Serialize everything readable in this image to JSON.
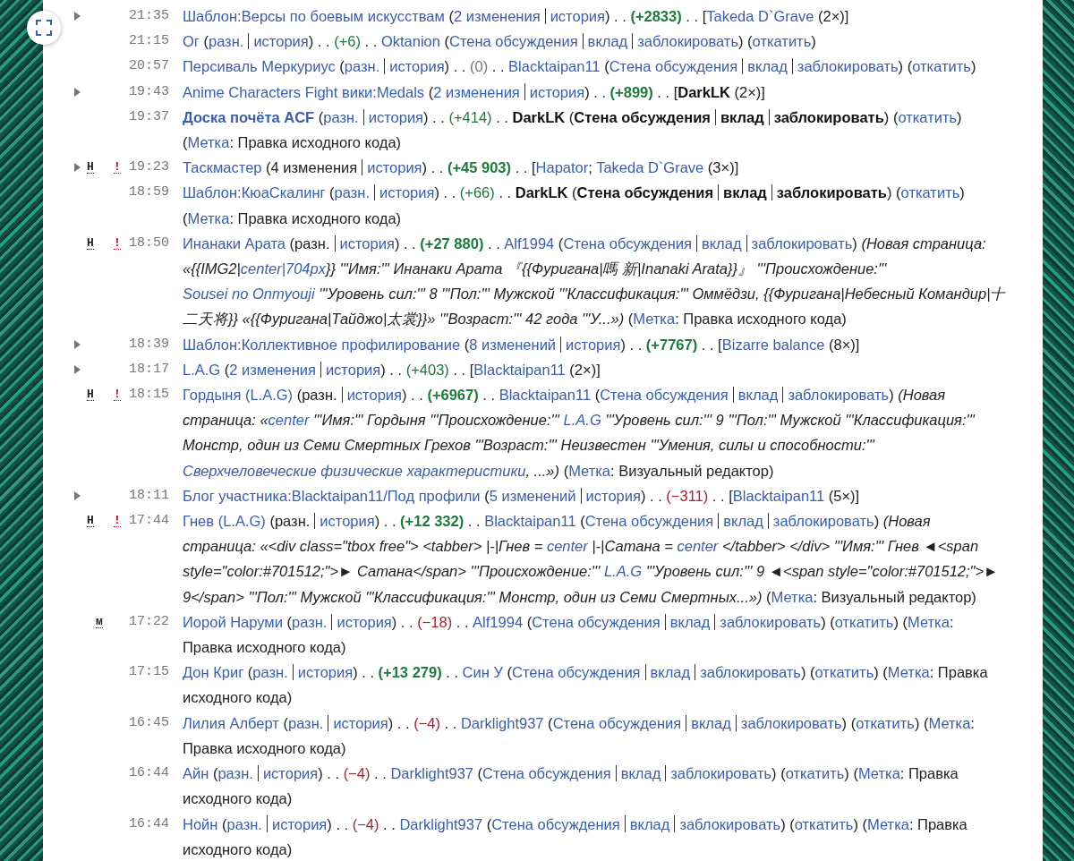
{
  "entries": [
    {
      "time": "21:35",
      "kind": "group",
      "expanded": false,
      "parts": [
        {
          "kind": "link",
          "t": "Шаблон:Версы по боевым искусствам"
        },
        {
          "kind": "text",
          "t": " ("
        },
        {
          "kind": "link",
          "t": "2 изменения"
        },
        {
          "kind": "sep"
        },
        {
          "kind": "link",
          "t": "история"
        },
        {
          "kind": "text",
          "t": ") . . "
        },
        {
          "kind": "size-up",
          "t": "(+2833)",
          "bold": true
        },
        {
          "kind": "text",
          "t": " . . ["
        },
        {
          "kind": "link",
          "t": "Takeda D`Grave"
        },
        {
          "kind": "text",
          "t": " (2×)]"
        }
      ]
    },
    {
      "time": "21:15",
      "kind": "single",
      "parts": [
        {
          "kind": "link",
          "t": "Ог"
        },
        {
          "kind": "text",
          "t": " ("
        },
        {
          "kind": "link",
          "t": "разн."
        },
        {
          "kind": "sep"
        },
        {
          "kind": "link",
          "t": "история"
        },
        {
          "kind": "text",
          "t": ") . . "
        },
        {
          "kind": "size-up",
          "t": "(+6)"
        },
        {
          "kind": "text",
          "t": " . . "
        },
        {
          "kind": "link",
          "t": "Oktanion"
        },
        {
          "kind": "text",
          "t": " ("
        },
        {
          "kind": "link",
          "t": "Стена обсуждения"
        },
        {
          "kind": "sep"
        },
        {
          "kind": "link",
          "t": "вклад"
        },
        {
          "kind": "sep"
        },
        {
          "kind": "link",
          "t": "заблокировать"
        },
        {
          "kind": "text",
          "t": ") ("
        },
        {
          "kind": "link",
          "t": "откатить"
        },
        {
          "kind": "text",
          "t": ")"
        }
      ]
    },
    {
      "time": "20:57",
      "kind": "single",
      "parts": [
        {
          "kind": "link",
          "t": "Персиваль Меркуриус"
        },
        {
          "kind": "text",
          "t": " ("
        },
        {
          "kind": "link",
          "t": "разн."
        },
        {
          "kind": "sep"
        },
        {
          "kind": "link",
          "t": "история"
        },
        {
          "kind": "text",
          "t": ") . . "
        },
        {
          "kind": "size-zero",
          "t": "(0)"
        },
        {
          "kind": "text",
          "t": " . . "
        },
        {
          "kind": "link",
          "t": "Blacktaipan11"
        },
        {
          "kind": "text",
          "t": " ("
        },
        {
          "kind": "link",
          "t": "Стена обсуждения"
        },
        {
          "kind": "sep"
        },
        {
          "kind": "link",
          "t": "вклад"
        },
        {
          "kind": "sep"
        },
        {
          "kind": "link",
          "t": "заблокировать"
        },
        {
          "kind": "text",
          "t": ") ("
        },
        {
          "kind": "link",
          "t": "откатить"
        },
        {
          "kind": "text",
          "t": ")"
        }
      ]
    },
    {
      "time": "19:43",
      "kind": "group",
      "expanded": false,
      "parts": [
        {
          "kind": "link",
          "t": "Anime Characters Fight вики:Medals"
        },
        {
          "kind": "text",
          "t": " ("
        },
        {
          "kind": "link",
          "t": "2 изменения"
        },
        {
          "kind": "sep"
        },
        {
          "kind": "link",
          "t": "история"
        },
        {
          "kind": "text",
          "t": ") . . "
        },
        {
          "kind": "size-up",
          "t": "(+899)",
          "bold": true
        },
        {
          "kind": "text",
          "t": " . . ["
        },
        {
          "kind": "self",
          "t": "DarkLK"
        },
        {
          "kind": "text",
          "t": " (2×)]"
        }
      ]
    },
    {
      "time": "19:37",
      "kind": "single",
      "parts": [
        {
          "kind": "link",
          "t": "Доска почёта ACF",
          "bold": true
        },
        {
          "kind": "text",
          "t": " ("
        },
        {
          "kind": "link",
          "t": "разн."
        },
        {
          "kind": "sep"
        },
        {
          "kind": "link",
          "t": "история"
        },
        {
          "kind": "text",
          "t": ") . . "
        },
        {
          "kind": "size-up",
          "t": "(+414)"
        },
        {
          "kind": "text",
          "t": " . . "
        },
        {
          "kind": "self",
          "t": "DarkLK"
        },
        {
          "kind": "text",
          "t": " ("
        },
        {
          "kind": "self",
          "t": "Стена обсуждения"
        },
        {
          "kind": "sep"
        },
        {
          "kind": "self",
          "t": "вклад"
        },
        {
          "kind": "sep"
        },
        {
          "kind": "self",
          "t": "заблокировать"
        },
        {
          "kind": "text",
          "t": ") ("
        },
        {
          "kind": "link",
          "t": "откатить"
        },
        {
          "kind": "text",
          "t": ") ("
        },
        {
          "kind": "link",
          "t": "Метка"
        },
        {
          "kind": "text",
          "t": ": Правка исходного кода)"
        }
      ]
    },
    {
      "time": "19:23",
      "kind": "group",
      "expanded": false,
      "flags": [
        {
          "kind": "new",
          "t": "Н"
        },
        {
          "kind": "unpatrolled",
          "t": "!"
        }
      ],
      "parts": [
        {
          "kind": "link",
          "t": "Таскмастер"
        },
        {
          "kind": "text",
          "t": " (4 изменения"
        },
        {
          "kind": "sep"
        },
        {
          "kind": "link",
          "t": "история"
        },
        {
          "kind": "text",
          "t": ") . . "
        },
        {
          "kind": "size-up",
          "t": "(+45 903)",
          "bold": true
        },
        {
          "kind": "text",
          "t": " . . ["
        },
        {
          "kind": "link",
          "t": "Hapator"
        },
        {
          "kind": "text",
          "t": "; "
        },
        {
          "kind": "link",
          "t": "Takeda D`Grave"
        },
        {
          "kind": "text",
          "t": " (3×)]"
        }
      ]
    },
    {
      "time": "18:59",
      "kind": "single",
      "parts": [
        {
          "kind": "link",
          "t": "Шаблон:КюаСкалинг"
        },
        {
          "kind": "text",
          "t": " ("
        },
        {
          "kind": "link",
          "t": "разн."
        },
        {
          "kind": "sep"
        },
        {
          "kind": "link",
          "t": "история"
        },
        {
          "kind": "text",
          "t": ") . . "
        },
        {
          "kind": "size-up",
          "t": "(+66)"
        },
        {
          "kind": "text",
          "t": " . . "
        },
        {
          "kind": "self",
          "t": "DarkLK"
        },
        {
          "kind": "text",
          "t": " ("
        },
        {
          "kind": "self",
          "t": "Стена обсуждения"
        },
        {
          "kind": "sep"
        },
        {
          "kind": "self",
          "t": "вклад"
        },
        {
          "kind": "sep"
        },
        {
          "kind": "self",
          "t": "заблокировать"
        },
        {
          "kind": "text",
          "t": ") ("
        },
        {
          "kind": "link",
          "t": "откатить"
        },
        {
          "kind": "text",
          "t": ") ("
        },
        {
          "kind": "link",
          "t": "Метка"
        },
        {
          "kind": "text",
          "t": ": Правка исходного кода)"
        }
      ]
    },
    {
      "time": "18:50",
      "kind": "single",
      "flags": [
        {
          "kind": "new",
          "t": "Н"
        },
        {
          "kind": "unpatrolled",
          "t": "!"
        }
      ],
      "parts": [
        {
          "kind": "link",
          "t": "Инанаки Арата"
        },
        {
          "kind": "text",
          "t": " (разн."
        },
        {
          "kind": "sep"
        },
        {
          "kind": "link",
          "t": "история"
        },
        {
          "kind": "text",
          "t": ") . . "
        },
        {
          "kind": "size-up",
          "t": "(+27 880)",
          "bold": true
        },
        {
          "kind": "text",
          "t": " . . "
        },
        {
          "kind": "link",
          "t": "Alf1994"
        },
        {
          "kind": "text",
          "t": " ("
        },
        {
          "kind": "link",
          "t": "Стена обсуждения"
        },
        {
          "kind": "sep"
        },
        {
          "kind": "link",
          "t": "вклад"
        },
        {
          "kind": "sep"
        },
        {
          "kind": "link",
          "t": "заблокировать"
        },
        {
          "kind": "text",
          "t": ") "
        },
        {
          "kind": "comment",
          "segs": [
            {
              "kind": "text",
              "t": "(Новая страница: «{{IMG2|"
            },
            {
              "kind": "link",
              "t": "center|704px"
            },
            {
              "kind": "text",
              "t": "}} '''Имя:''' Инанаки Арата 『{{Фуригана|嗎 新|Inanaki Arata}}』 '''Происхождение:''' "
            },
            {
              "kind": "link",
              "t": "Sousei no Onmyouji"
            },
            {
              "kind": "text",
              "t": " '''Уровень сил:''' 8 '''Пол:''' Мужской '''Классификация:''' Оммёдзи, {{Фуригана|Небесный Командир|十二天将}} «{{Фуригана|Тайджо|太裳}}» '''Возраст:''' 42 года '''У...»)"
            }
          ]
        },
        {
          "kind": "text",
          "t": " ("
        },
        {
          "kind": "link",
          "t": "Метка"
        },
        {
          "kind": "text",
          "t": ": Правка исходного кода)"
        }
      ]
    },
    {
      "time": "18:39",
      "kind": "group",
      "expanded": false,
      "parts": [
        {
          "kind": "link",
          "t": "Шаблон:Коллективное профилирование"
        },
        {
          "kind": "text",
          "t": " ("
        },
        {
          "kind": "link",
          "t": "8 изменений"
        },
        {
          "kind": "sep"
        },
        {
          "kind": "link",
          "t": "история"
        },
        {
          "kind": "text",
          "t": ") . . "
        },
        {
          "kind": "size-up",
          "t": "(+7767)",
          "bold": true
        },
        {
          "kind": "text",
          "t": " . . ["
        },
        {
          "kind": "link",
          "t": "Bizarre balance"
        },
        {
          "kind": "text",
          "t": " (8×)]"
        }
      ]
    },
    {
      "time": "18:17",
      "kind": "group",
      "expanded": false,
      "parts": [
        {
          "kind": "link",
          "t": "L.A.G"
        },
        {
          "kind": "text",
          "t": " ("
        },
        {
          "kind": "link",
          "t": "2 изменения"
        },
        {
          "kind": "sep"
        },
        {
          "kind": "link",
          "t": "история"
        },
        {
          "kind": "text",
          "t": ") . . "
        },
        {
          "kind": "size-up",
          "t": "(+403)"
        },
        {
          "kind": "text",
          "t": " . . ["
        },
        {
          "kind": "link",
          "t": "Blacktaipan11"
        },
        {
          "kind": "text",
          "t": " (2×)]"
        }
      ]
    },
    {
      "time": "18:15",
      "kind": "single",
      "flags": [
        {
          "kind": "new",
          "t": "Н"
        },
        {
          "kind": "unpatrolled",
          "t": "!"
        }
      ],
      "parts": [
        {
          "kind": "link",
          "t": "Гордыня (L.A.G)"
        },
        {
          "kind": "text",
          "t": " (разн."
        },
        {
          "kind": "sep"
        },
        {
          "kind": "link",
          "t": "история"
        },
        {
          "kind": "text",
          "t": ") . . "
        },
        {
          "kind": "size-up",
          "t": "(+6967)",
          "bold": true
        },
        {
          "kind": "text",
          "t": " . . "
        },
        {
          "kind": "link",
          "t": "Blacktaipan11"
        },
        {
          "kind": "text",
          "t": " ("
        },
        {
          "kind": "link",
          "t": "Стена обсуждения"
        },
        {
          "kind": "sep"
        },
        {
          "kind": "link",
          "t": "вклад"
        },
        {
          "kind": "sep"
        },
        {
          "kind": "link",
          "t": "заблокировать"
        },
        {
          "kind": "text",
          "t": ") "
        },
        {
          "kind": "comment",
          "segs": [
            {
              "kind": "text",
              "t": "(Новая страница: «"
            },
            {
              "kind": "link",
              "t": "center"
            },
            {
              "kind": "text",
              "t": " '''Имя:''' Гордыня '''Происхождение:''' "
            },
            {
              "kind": "link",
              "t": "L.A.G"
            },
            {
              "kind": "text",
              "t": " '''Уровень сил:''' 9 '''Пол:''' Мужской '''Классификация:''' Монстр, один из Семи Смертных Грехов '''Возраст:''' Неизвестен '''Умения, силы и способности:''' "
            },
            {
              "kind": "link",
              "t": "Сверхчеловеческие физические характеристики"
            },
            {
              "kind": "text",
              "t": ", ...»)"
            }
          ]
        },
        {
          "kind": "text",
          "t": " ("
        },
        {
          "kind": "link",
          "t": "Метка"
        },
        {
          "kind": "text",
          "t": ": Визуальный редактор)"
        }
      ]
    },
    {
      "time": "18:11",
      "kind": "group",
      "expanded": false,
      "parts": [
        {
          "kind": "link",
          "t": "Блог участника:Blacktaipan11/Под профили"
        },
        {
          "kind": "text",
          "t": " ("
        },
        {
          "kind": "link",
          "t": "5 изменений"
        },
        {
          "kind": "sep"
        },
        {
          "kind": "link",
          "t": "история"
        },
        {
          "kind": "text",
          "t": ") . . "
        },
        {
          "kind": "size-down",
          "t": "(−311)"
        },
        {
          "kind": "text",
          "t": " . . ["
        },
        {
          "kind": "link",
          "t": "Blacktaipan11"
        },
        {
          "kind": "text",
          "t": " (5×)]"
        }
      ]
    },
    {
      "time": "17:44",
      "kind": "single",
      "flags": [
        {
          "kind": "new",
          "t": "Н"
        },
        {
          "kind": "unpatrolled",
          "t": "!"
        }
      ],
      "parts": [
        {
          "kind": "link",
          "t": "Гнев (L.A.G)"
        },
        {
          "kind": "text",
          "t": " (разн."
        },
        {
          "kind": "sep"
        },
        {
          "kind": "link",
          "t": "история"
        },
        {
          "kind": "text",
          "t": ") . . "
        },
        {
          "kind": "size-up",
          "t": "(+12 332)",
          "bold": true
        },
        {
          "kind": "text",
          "t": " . . "
        },
        {
          "kind": "link",
          "t": "Blacktaipan11"
        },
        {
          "kind": "text",
          "t": " ("
        },
        {
          "kind": "link",
          "t": "Стена обсуждения"
        },
        {
          "kind": "sep"
        },
        {
          "kind": "link",
          "t": "вклад"
        },
        {
          "kind": "sep"
        },
        {
          "kind": "link",
          "t": "заблокировать"
        },
        {
          "kind": "text",
          "t": ") "
        },
        {
          "kind": "comment",
          "segs": [
            {
              "kind": "text",
              "t": "(Новая страница: «<div class=\"tbox free\"> <tabber> |-|Гнев = "
            },
            {
              "kind": "link",
              "t": "center"
            },
            {
              "kind": "text",
              "t": " |-|Сатана = "
            },
            {
              "kind": "link",
              "t": "center"
            },
            {
              "kind": "text",
              "t": " </tabber> </div> '''Имя:''' Гнев ◄<span style=\"color:#701512;\">► Сатана</span> '''Происхождение:''' "
            },
            {
              "kind": "link",
              "t": "L.A.G"
            },
            {
              "kind": "text",
              "t": " '''Уровень сил:''' 9 ◄<span style=\"color:#701512;\">► 9</span> '''Пол:''' Мужской '''Классификация:''' Монстр, один из Семи Смертных...»)"
            }
          ]
        },
        {
          "kind": "text",
          "t": " ("
        },
        {
          "kind": "link",
          "t": "Метка"
        },
        {
          "kind": "text",
          "t": ": Визуальный редактор)"
        }
      ]
    },
    {
      "time": "17:22",
      "kind": "single",
      "flags": [
        {
          "kind": "minor",
          "t": "м"
        }
      ],
      "parts": [
        {
          "kind": "link",
          "t": "Иорой Наруми"
        },
        {
          "kind": "text",
          "t": " ("
        },
        {
          "kind": "link",
          "t": "разн."
        },
        {
          "kind": "sep"
        },
        {
          "kind": "link",
          "t": "история"
        },
        {
          "kind": "text",
          "t": ") . . "
        },
        {
          "kind": "size-down",
          "t": "(−18)"
        },
        {
          "kind": "text",
          "t": " . . "
        },
        {
          "kind": "link",
          "t": "Alf1994"
        },
        {
          "kind": "text",
          "t": " ("
        },
        {
          "kind": "link",
          "t": "Стена обсуждения"
        },
        {
          "kind": "sep"
        },
        {
          "kind": "link",
          "t": "вклад"
        },
        {
          "kind": "sep"
        },
        {
          "kind": "link",
          "t": "заблокировать"
        },
        {
          "kind": "text",
          "t": ") ("
        },
        {
          "kind": "link",
          "t": "откатить"
        },
        {
          "kind": "text",
          "t": ") ("
        },
        {
          "kind": "link",
          "t": "Метка"
        },
        {
          "kind": "text",
          "t": ": Правка исходного кода)"
        }
      ]
    },
    {
      "time": "17:15",
      "kind": "single",
      "parts": [
        {
          "kind": "link",
          "t": "Дон Криг"
        },
        {
          "kind": "text",
          "t": " ("
        },
        {
          "kind": "link",
          "t": "разн."
        },
        {
          "kind": "sep"
        },
        {
          "kind": "link",
          "t": "история"
        },
        {
          "kind": "text",
          "t": ") . . "
        },
        {
          "kind": "size-up",
          "t": "(+13 279)",
          "bold": true
        },
        {
          "kind": "text",
          "t": " . . "
        },
        {
          "kind": "link",
          "t": "Син У"
        },
        {
          "kind": "text",
          "t": " ("
        },
        {
          "kind": "link",
          "t": "Стена обсуждения"
        },
        {
          "kind": "sep"
        },
        {
          "kind": "link",
          "t": "вклад"
        },
        {
          "kind": "sep"
        },
        {
          "kind": "link",
          "t": "заблокировать"
        },
        {
          "kind": "text",
          "t": ") ("
        },
        {
          "kind": "link",
          "t": "откатить"
        },
        {
          "kind": "text",
          "t": ") ("
        },
        {
          "kind": "link",
          "t": "Метка"
        },
        {
          "kind": "text",
          "t": ": Правка исходного кода)"
        }
      ]
    },
    {
      "time": "16:45",
      "kind": "single",
      "parts": [
        {
          "kind": "link",
          "t": "Лилия Алберт"
        },
        {
          "kind": "text",
          "t": " ("
        },
        {
          "kind": "link",
          "t": "разн."
        },
        {
          "kind": "sep"
        },
        {
          "kind": "link",
          "t": "история"
        },
        {
          "kind": "text",
          "t": ") . . "
        },
        {
          "kind": "size-down",
          "t": "(−4)"
        },
        {
          "kind": "text",
          "t": " . . "
        },
        {
          "kind": "link",
          "t": "Darklight937"
        },
        {
          "kind": "text",
          "t": " ("
        },
        {
          "kind": "link",
          "t": "Стена обсуждения"
        },
        {
          "kind": "sep"
        },
        {
          "kind": "link",
          "t": "вклад"
        },
        {
          "kind": "sep"
        },
        {
          "kind": "link",
          "t": "заблокировать"
        },
        {
          "kind": "text",
          "t": ") ("
        },
        {
          "kind": "link",
          "t": "откатить"
        },
        {
          "kind": "text",
          "t": ") ("
        },
        {
          "kind": "link",
          "t": "Метка"
        },
        {
          "kind": "text",
          "t": ": Правка исходного кода)"
        }
      ]
    },
    {
      "time": "16:44",
      "kind": "single",
      "parts": [
        {
          "kind": "link",
          "t": "Айн"
        },
        {
          "kind": "text",
          "t": " ("
        },
        {
          "kind": "link",
          "t": "разн."
        },
        {
          "kind": "sep"
        },
        {
          "kind": "link",
          "t": "история"
        },
        {
          "kind": "text",
          "t": ") . . "
        },
        {
          "kind": "size-down",
          "t": "(−4)"
        },
        {
          "kind": "text",
          "t": " . . "
        },
        {
          "kind": "link",
          "t": "Darklight937"
        },
        {
          "kind": "text",
          "t": " ("
        },
        {
          "kind": "link",
          "t": "Стена обсуждения"
        },
        {
          "kind": "sep"
        },
        {
          "kind": "link",
          "t": "вклад"
        },
        {
          "kind": "sep"
        },
        {
          "kind": "link",
          "t": "заблокировать"
        },
        {
          "kind": "text",
          "t": ") ("
        },
        {
          "kind": "link",
          "t": "откатить"
        },
        {
          "kind": "text",
          "t": ") ("
        },
        {
          "kind": "link",
          "t": "Метка"
        },
        {
          "kind": "text",
          "t": ": Правка исходного кода)"
        }
      ]
    },
    {
      "time": "16:44",
      "kind": "single",
      "parts": [
        {
          "kind": "link",
          "t": "Нойн"
        },
        {
          "kind": "text",
          "t": " ("
        },
        {
          "kind": "link",
          "t": "разн."
        },
        {
          "kind": "sep"
        },
        {
          "kind": "link",
          "t": "история"
        },
        {
          "kind": "text",
          "t": ") . . "
        },
        {
          "kind": "size-down",
          "t": "(−4)"
        },
        {
          "kind": "text",
          "t": " . . "
        },
        {
          "kind": "link",
          "t": "Darklight937"
        },
        {
          "kind": "text",
          "t": " ("
        },
        {
          "kind": "link",
          "t": "Стена обсуждения"
        },
        {
          "kind": "sep"
        },
        {
          "kind": "link",
          "t": "вклад"
        },
        {
          "kind": "sep"
        },
        {
          "kind": "link",
          "t": "заблокировать"
        },
        {
          "kind": "text",
          "t": ") ("
        },
        {
          "kind": "link",
          "t": "откатить"
        },
        {
          "kind": "text",
          "t": ") ("
        },
        {
          "kind": "link",
          "t": "Метка"
        },
        {
          "kind": "text",
          "t": ": Правка исходного кода)"
        }
      ]
    }
  ]
}
